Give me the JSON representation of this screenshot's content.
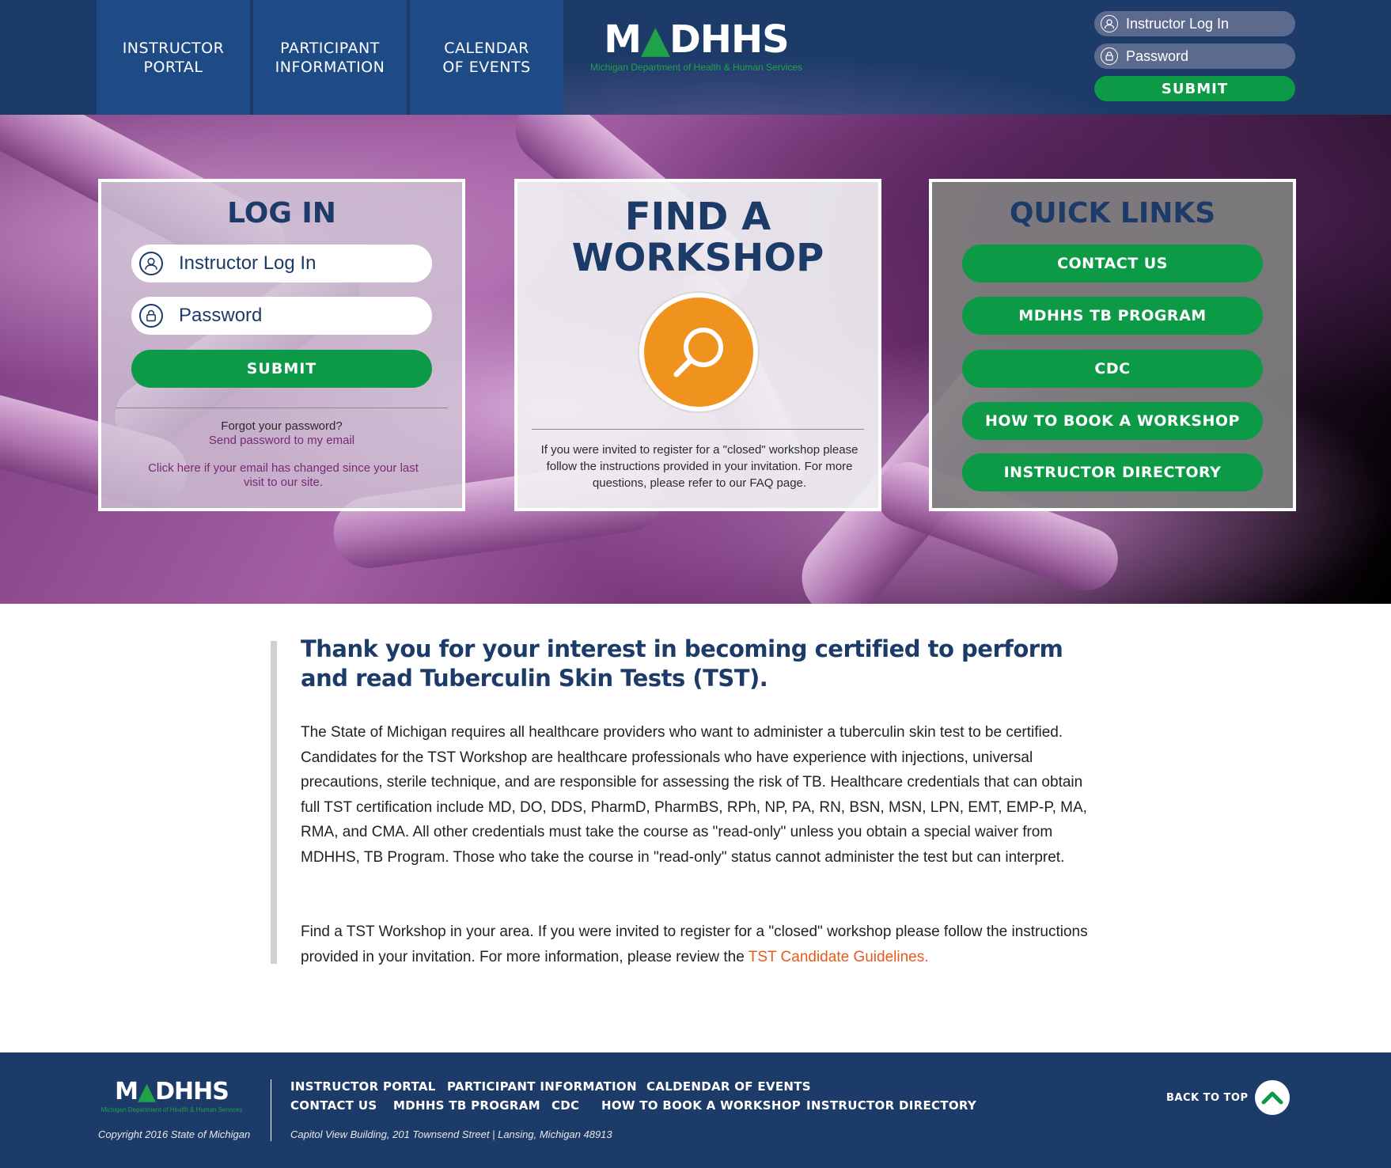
{
  "header": {
    "nav": [
      {
        "label": "INSTRUCTOR\nPORTAL"
      },
      {
        "label": "PARTICIPANT\nINFORMATION"
      },
      {
        "label": "CALENDAR\nOF EVENTS"
      }
    ],
    "logo": {
      "word_m": "M",
      "word_rest": "DHHS",
      "subtitle": "Michigan Department of Health & Human Services"
    },
    "login": {
      "username_placeholder": "Instructor Log In",
      "password_placeholder": "Password",
      "submit_label": "SUBMIT"
    }
  },
  "hero": {
    "login_panel": {
      "title": "LOG IN",
      "username_placeholder": "Instructor Log In",
      "password_placeholder": "Password",
      "submit_label": "SUBMIT",
      "forgot_text": "Forgot your password?",
      "send_link": "Send password to my email",
      "changed_link": "Click here if your email has changed since your last visit to our site."
    },
    "find_panel": {
      "title_line1": "FIND A",
      "title_line2": "WORKSHOP",
      "text": "If you were invited to register for a \"closed\" workshop please follow the instructions provided in your invitation. For more questions, please refer to our FAQ page."
    },
    "quick_panel": {
      "title": "QUICK LINKS",
      "links": [
        {
          "label": "CONTACT US"
        },
        {
          "label": "MDHHS TB PROGRAM"
        },
        {
          "label": "CDC"
        },
        {
          "label": "HOW TO BOOK A WORKSHOP"
        },
        {
          "label": "INSTRUCTOR DIRECTORY"
        }
      ]
    }
  },
  "content": {
    "heading": "Thank you for your interest in becoming certified to perform and read Tuberculin Skin Tests (TST).",
    "paragraph1": "The State of Michigan requires all healthcare providers who want to administer a tuberculin skin test to be certified. Candidates for the TST Workshop are healthcare professionals who have experience with injections, universal precautions, sterile technique, and are responsible for assessing the risk of TB. Healthcare credentials that can obtain full TST certification include MD, DO, DDS, PharmD, PharmBS, RPh, NP, PA, RN, BSN, MSN, LPN, EMT, EMP-P, MA, RMA, and CMA. All other credentials must take the course as \"read-only\" unless you obtain a special waiver from MDHHS, TB Program. Those who take the course in \"read-only\" status cannot administer the test but can interpret.",
    "paragraph2": "Find a TST Workshop in your area.  If you were invited to register for a \"closed\" workshop please follow the instructions provided in your invitation.  For more information, please review the ",
    "guidelines_link": "TST Candidate Guidelines."
  },
  "footer": {
    "copyright": "Copyright 2016 State of Michigan",
    "links_row1": [
      "INSTRUCTOR PORTAL",
      "PARTICIPANT INFORMATION",
      "CALDENDAR OF EVENTS"
    ],
    "links_row2": [
      "CONTACT US",
      "MDHHS TB PROGRAM",
      "CDC",
      "HOW TO BOOK A WORKSHOP",
      "INSTRUCTOR DIRECTORY"
    ],
    "address": "Capitol View Building, 201 Townsend Street  |  Lansing, Michigan 48913",
    "back_to_top": "BACK TO TOP"
  },
  "colors": {
    "navy": "#1c3b68",
    "nav_blue": "#1e4b86",
    "green": "#0d9a47",
    "orange": "#f0921e",
    "link_orange": "#e85a1e",
    "link_purple": "#7a2a72"
  },
  "icons": [
    "user-icon",
    "lock-icon",
    "search-icon",
    "michigan-map-icon",
    "chevron-up-icon"
  ]
}
